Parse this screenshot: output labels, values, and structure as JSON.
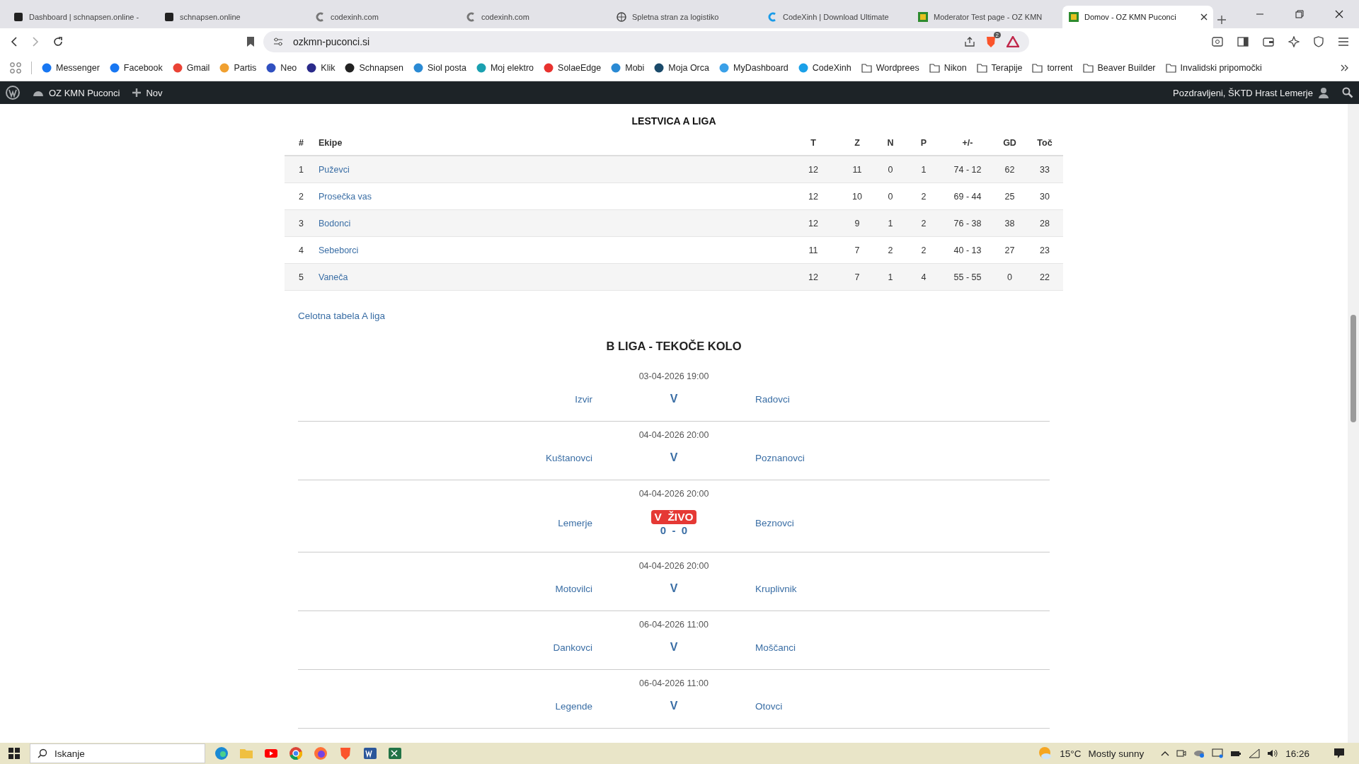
{
  "browser": {
    "tabs": [
      {
        "title": "Dashboard | schnapsen.online -",
        "selected": false
      },
      {
        "title": "schnapsen.online",
        "selected": false
      },
      {
        "title": "codexinh.com",
        "selected": false
      },
      {
        "title": "codexinh.com",
        "selected": false
      },
      {
        "title": "Spletna stran za logistiko",
        "selected": false
      },
      {
        "title": "CodeXinh | Download Ultimate",
        "selected": false
      },
      {
        "title": "Moderator Test page - OZ KMN",
        "selected": false
      },
      {
        "title": "Domov - OZ KMN Puconci",
        "selected": true
      }
    ],
    "url": "ozkmn-puconci.si",
    "shield_badge": "2",
    "bookmarks": [
      {
        "label": "Messenger",
        "kind": "site"
      },
      {
        "label": "Facebook",
        "kind": "site"
      },
      {
        "label": "Gmail",
        "kind": "site"
      },
      {
        "label": "Partis",
        "kind": "site"
      },
      {
        "label": "Neo",
        "kind": "site"
      },
      {
        "label": "Klik",
        "kind": "site"
      },
      {
        "label": "Schnapsen",
        "kind": "site"
      },
      {
        "label": "Siol posta",
        "kind": "site"
      },
      {
        "label": "Moj elektro",
        "kind": "site"
      },
      {
        "label": "SolaeEdge",
        "kind": "site"
      },
      {
        "label": "Mobi",
        "kind": "site"
      },
      {
        "label": "Moja Orca",
        "kind": "site"
      },
      {
        "label": "MyDashboard",
        "kind": "site"
      },
      {
        "label": "CodeXinh",
        "kind": "site"
      },
      {
        "label": "Wordprees",
        "kind": "folder"
      },
      {
        "label": "Nikon",
        "kind": "folder"
      },
      {
        "label": "Terapije",
        "kind": "folder"
      },
      {
        "label": "torrent",
        "kind": "folder"
      },
      {
        "label": "Beaver Builder",
        "kind": "folder"
      },
      {
        "label": "Invalidski pripomočki",
        "kind": "folder"
      }
    ]
  },
  "admin_bar": {
    "site_name": "OZ KMN Puconci",
    "new_label": "Nov",
    "greeting": "Pozdravljeni, ŠKTD Hrast Lemerje"
  },
  "standings": {
    "title": "LESTVICA A LIGA",
    "columns": [
      "#",
      "Ekipe",
      "T",
      "Z",
      "N",
      "P",
      "+/-",
      "GD",
      "Toč"
    ],
    "rows": [
      [
        "1",
        "Puževci",
        "12",
        "11",
        "0",
        "1",
        "74 - 12",
        "62",
        "33"
      ],
      [
        "2",
        "Prosečka vas",
        "12",
        "10",
        "0",
        "2",
        "69 - 44",
        "25",
        "30"
      ],
      [
        "3",
        "Bodonci",
        "12",
        "9",
        "1",
        "2",
        "76 - 38",
        "38",
        "28"
      ],
      [
        "4",
        "Sebeborci",
        "11",
        "7",
        "2",
        "2",
        "40 - 13",
        "27",
        "23"
      ],
      [
        "5",
        "Vaneča",
        "12",
        "7",
        "1",
        "4",
        "55 - 55",
        "0",
        "22"
      ]
    ]
  },
  "full_table_link": "Celotna tabela A liga",
  "fixtures": {
    "title": "B LIGA - TEKOČE KOLO",
    "matches": [
      {
        "kind": "upcoming",
        "date": "03-04-2026 19:00",
        "home": "Izvir",
        "center": "V",
        "away": "Radovci"
      },
      {
        "kind": "upcoming",
        "date": "04-04-2026 20:00",
        "home": "Kuštanovci",
        "center": "V",
        "away": "Poznanovci"
      },
      {
        "kind": "live",
        "date": "04-04-2026 20:00",
        "home": "Lemerje",
        "center": "V  ŽIVO",
        "score": "0  -  0",
        "away": "Beznovci"
      },
      {
        "kind": "upcoming",
        "date": "04-04-2026 20:00",
        "home": "Motovilci",
        "center": "V",
        "away": "Kruplivnik"
      },
      {
        "kind": "upcoming",
        "date": "06-04-2026 11:00",
        "home": "Dankovci",
        "center": "V",
        "away": "Moščanci"
      },
      {
        "kind": "upcoming",
        "date": "06-04-2026 11:00",
        "home": "Legende",
        "center": "V",
        "away": "Otovci"
      }
    ]
  },
  "taskbar": {
    "search_placeholder": "Iskanje",
    "temperature": "15°C",
    "weather": "Mostly sunny",
    "time": "16:26"
  }
}
